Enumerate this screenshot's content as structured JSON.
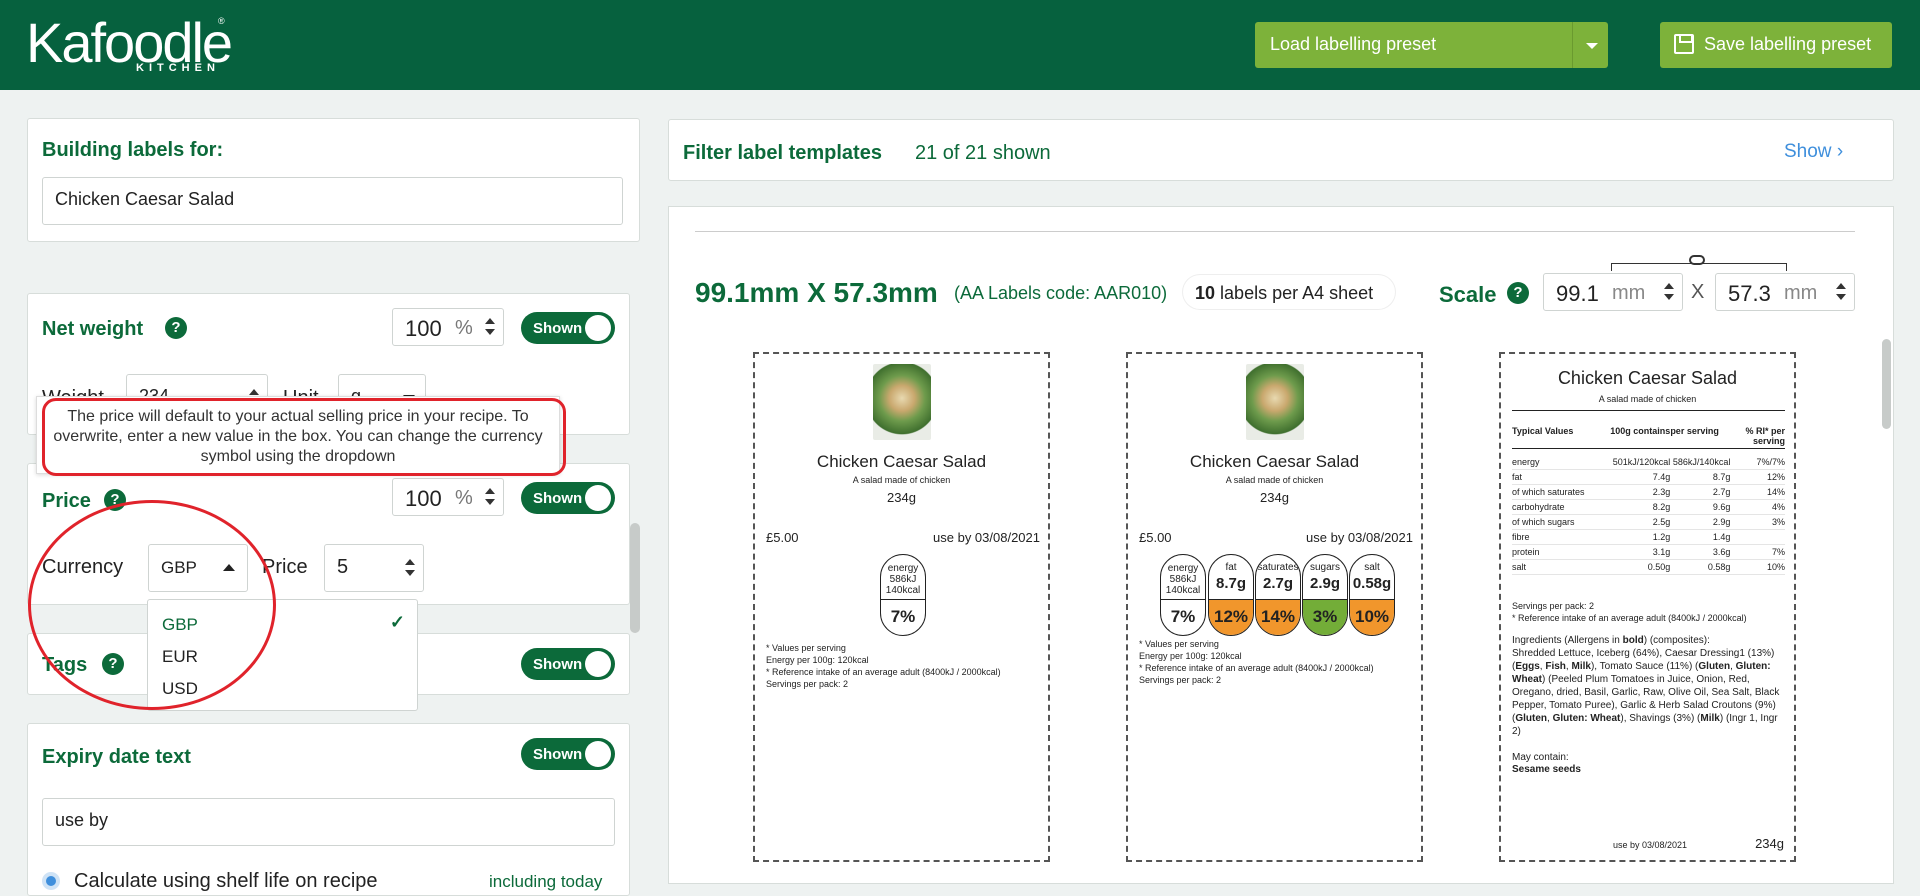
{
  "app": {
    "logo": "Kafoodle",
    "logo_sub": "KITCHEN",
    "logo_reg": "®"
  },
  "toolbar": {
    "load_preset": "Load labelling preset",
    "save_preset": "Save labelling preset"
  },
  "left": {
    "building_title": "Building labels for:",
    "recipe_name": "Chicken Caesar Salad",
    "net_weight": {
      "title": "Net weight",
      "help": "?",
      "percent": "100",
      "pct_sym": "%",
      "toggle": "Shown",
      "weight_label": "Weight",
      "weight_value": "234",
      "unit_label": "Unit",
      "unit_value": "g"
    },
    "tooltip": "The price will default to your actual selling price in your recipe. To overwrite, enter a new value in the box. You can change the currency symbol using the dropdown",
    "price": {
      "title": "Price",
      "help": "?",
      "percent": "100",
      "pct_sym": "%",
      "toggle": "Shown",
      "currency_label": "Currency",
      "currency_value": "GBP",
      "price_label": "Price",
      "price_value": "5"
    },
    "currency_options": [
      "GBP",
      "EUR",
      "USD"
    ],
    "currency_check": "✓",
    "tags": {
      "title": "Tags",
      "help": "?",
      "toggle": "Shown"
    },
    "expiry": {
      "title": "Expiry date text",
      "toggle": "Shown",
      "value": "use by",
      "calc_label": "Calculate using shelf life on recipe",
      "including": "including today"
    }
  },
  "filter": {
    "title": "Filter label templates",
    "count": "21 of 21 shown",
    "show": "Show",
    "show_chev": "›"
  },
  "template": {
    "size": "99.1mm X 57.3mm",
    "code": "(AA Labels code: AAR010)",
    "per_sheet_num": "10",
    "per_sheet_text": "labels per A4 sheet",
    "scale_label": "Scale",
    "scale_help": "?",
    "width_value": "99.1",
    "height_value": "57.3",
    "unit": "mm",
    "times": "X"
  },
  "label_common": {
    "title": "Chicken Caesar Salad",
    "subtitle": "A salad made of chicken",
    "weight": "234g",
    "price": "£5.00",
    "use_by": "use by 03/08/2021",
    "foot1": "* Values per serving",
    "foot2": "Energy per 100g: 120kcal",
    "foot3": "* Reference intake of an average adult (8400kJ / 2000kcal)",
    "foot4": "Servings per pack: 2"
  },
  "energy_chip": {
    "l1": "energy",
    "l2": "586kJ",
    "l3": "140kcal",
    "pct": "7%"
  },
  "chips": [
    {
      "name": "fat",
      "val": "8.7g",
      "pct": "12%",
      "color": "#f1962c"
    },
    {
      "name": "saturates",
      "val": "2.7g",
      "pct": "14%",
      "color": "#f1962c"
    },
    {
      "name": "sugars",
      "val": "2.9g",
      "pct": "3%",
      "color": "#73ad38"
    },
    {
      "name": "salt",
      "val": "0.58g",
      "pct": "10%",
      "color": "#f1962c"
    }
  ],
  "nutrition": {
    "h_typical": "Typical Values",
    "h_100g": "100g contains",
    "h_serving": "per serving",
    "h_ri": "% RI* per serving",
    "rows": [
      {
        "name": "energy",
        "a": "501kJ/120kcal",
        "b": "586kJ/140kcal",
        "c": "7%/7%"
      },
      {
        "name": "fat",
        "a": "7.4g",
        "b": "8.7g",
        "c": "12%"
      },
      {
        "name": "of which saturates",
        "a": "2.3g",
        "b": "2.7g",
        "c": "14%"
      },
      {
        "name": "carbohydrate",
        "a": "8.2g",
        "b": "9.6g",
        "c": "4%"
      },
      {
        "name": "of which sugars",
        "a": "2.5g",
        "b": "2.9g",
        "c": "3%"
      },
      {
        "name": "fibre",
        "a": "1.2g",
        "b": "1.4g",
        "c": ""
      },
      {
        "name": "protein",
        "a": "3.1g",
        "b": "3.6g",
        "c": "7%"
      },
      {
        "name": "salt",
        "a": "0.50g",
        "b": "0.58g",
        "c": "10%"
      }
    ],
    "servings": "Servings per pack: 2",
    "ref": "* Reference intake of an average adult (8400kJ / 2000kcal)",
    "ingredients_html": "Ingredients (Allergens in <b>bold</b>) (composites):<br>Shredded Lettuce, Iceberg (64%), Caesar Dressing1 (13%) (<b>Eggs</b>, <b>Fish</b>, <b>Milk</b>), Tomato Sauce (11%) (<b>Gluten</b>, <b>Gluten: Wheat</b>) (Peeled Plum Tomatoes in Juice, Onion, Red, Oregano, dried, Basil, Garlic, Raw, Olive Oil, Sea Salt, Black Pepper, Tomato Puree), Garlic &amp; Herb Salad Croutons (9%) (<b>Gluten</b>, <b>Gluten: Wheat</b>), Shavings (3%) (<b>Milk</b>) (Ingr 1, Ingr 2)",
    "may_contain": "May contain:",
    "may_item": "Sesame seeds",
    "use_by": "use by 03/08/2021",
    "weight": "234g"
  }
}
